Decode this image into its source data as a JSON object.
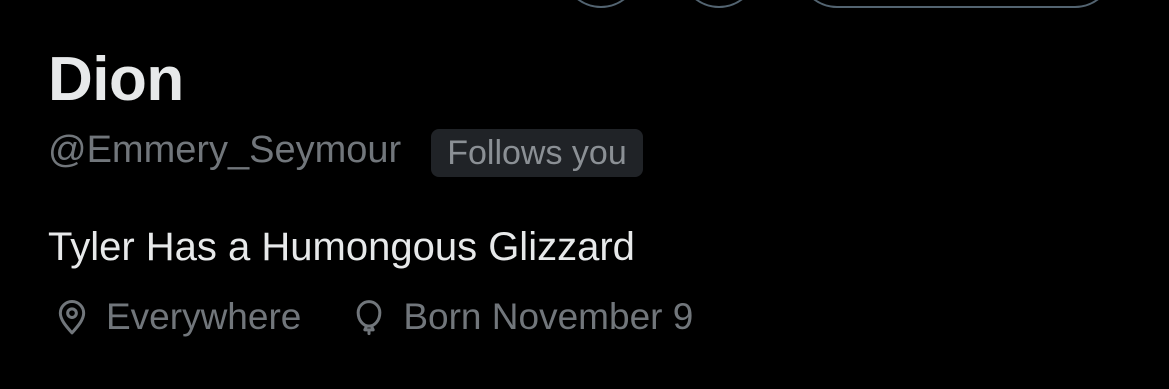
{
  "profile": {
    "display_name": "Dion",
    "handle": "@Emmery_Seymour",
    "follows_badge": "Follows you",
    "bio": "Tyler Has a Humongous Glizzard"
  },
  "meta": {
    "location": {
      "icon": "location-pin-icon",
      "text": "Everywhere"
    },
    "birthday": {
      "icon": "balloon-icon",
      "text": "Born November 9"
    }
  },
  "colors": {
    "background": "#000000",
    "primary_text": "#e7e9ea",
    "secondary_text": "#71767b",
    "badge_background": "#202327",
    "button_border": "#536471"
  }
}
